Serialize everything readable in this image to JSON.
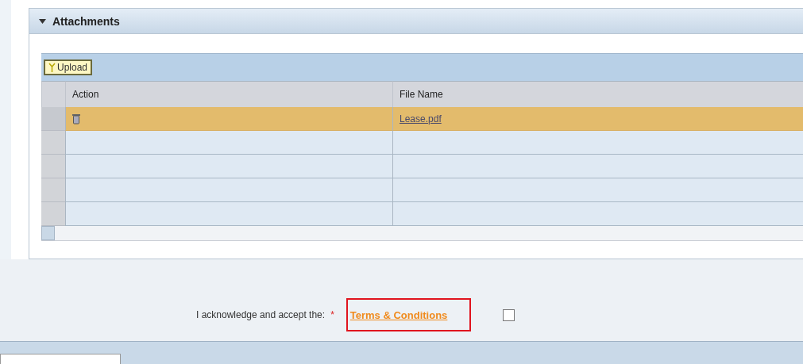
{
  "panel": {
    "title": "Attachments",
    "expanded": true
  },
  "toolbar": {
    "upload_button": "Upload"
  },
  "table": {
    "columns": [
      "Action",
      "File Name"
    ],
    "rows": [
      {
        "selected": true,
        "has_delete": true,
        "file_name": "Lease.pdf"
      },
      {
        "selected": false,
        "has_delete": false
      },
      {
        "selected": false,
        "has_delete": false
      },
      {
        "selected": false,
        "has_delete": false
      },
      {
        "selected": false,
        "has_delete": false
      }
    ]
  },
  "acknowledgement": {
    "label": "I acknowledge and accept the:",
    "required_mark": "*",
    "link": "Terms & Conditions",
    "highlighted": true,
    "checked": false
  }
}
